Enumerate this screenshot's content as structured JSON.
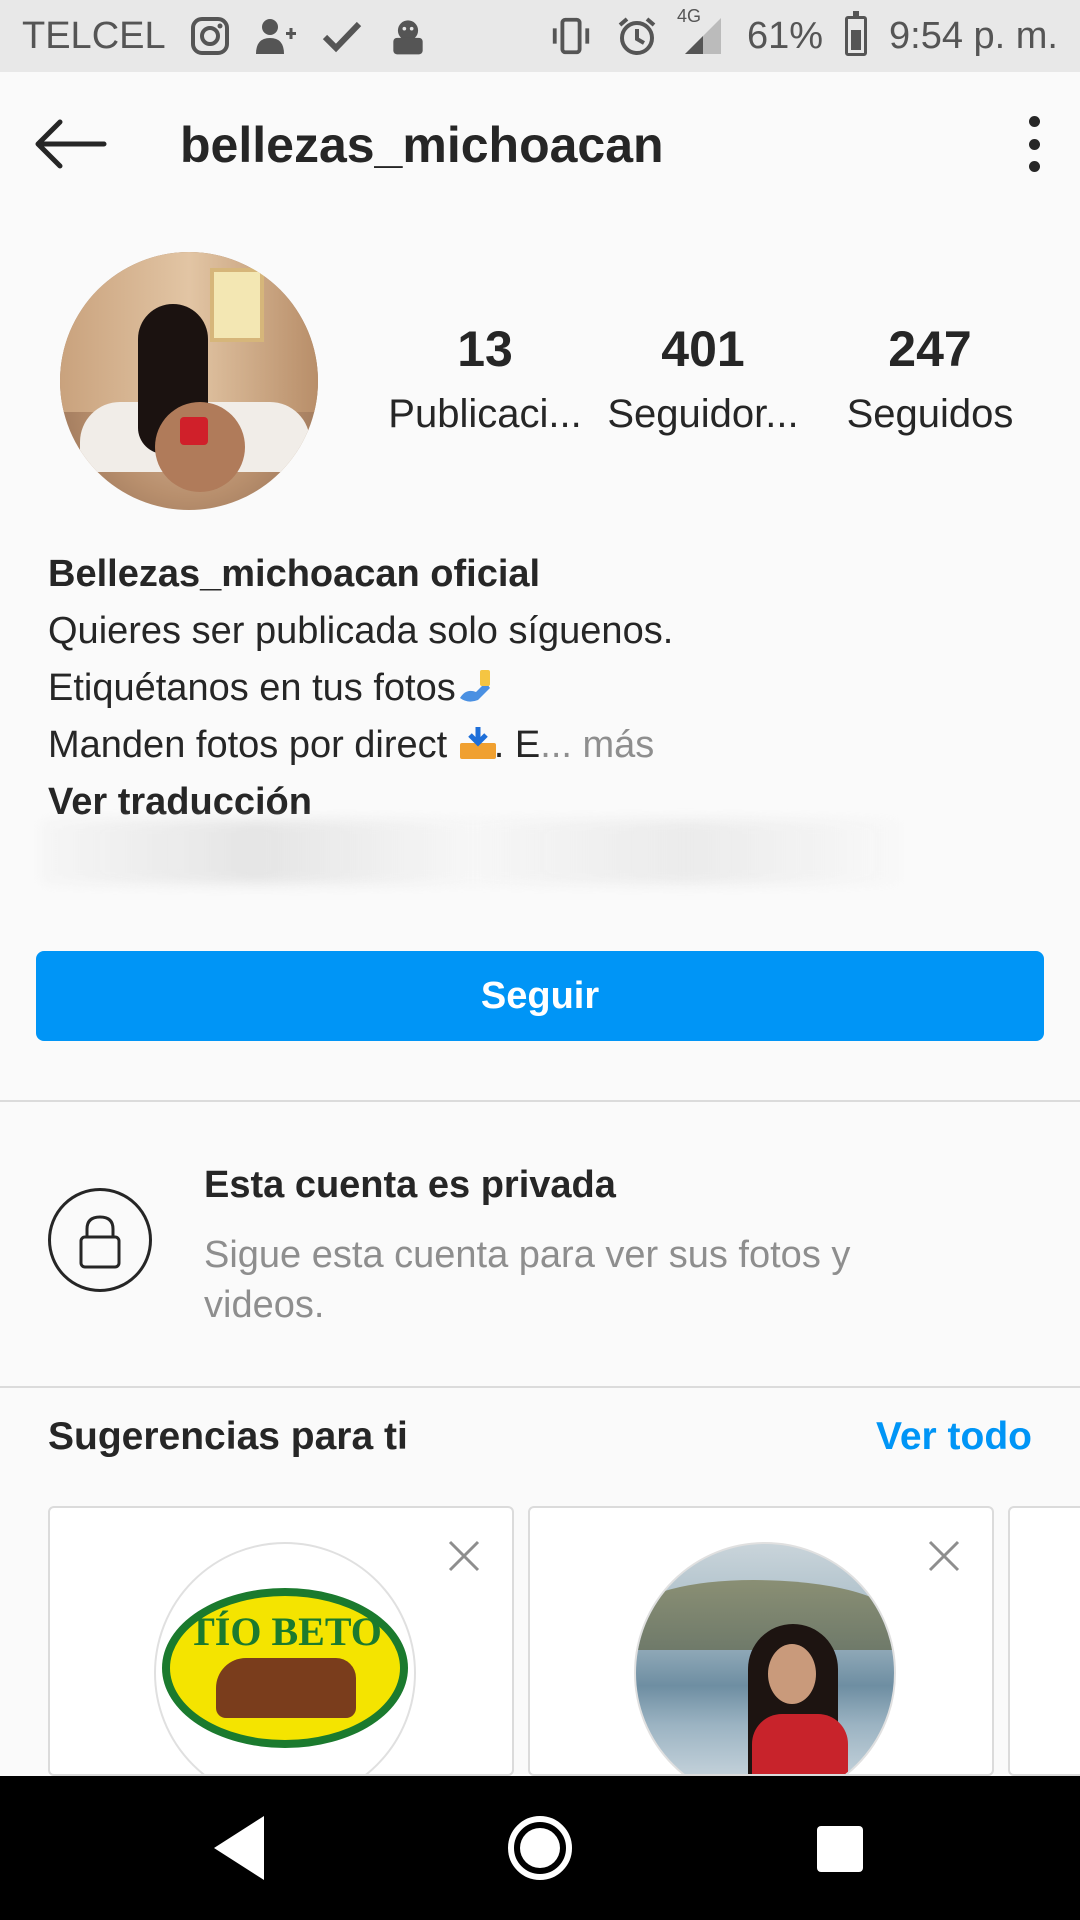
{
  "status_bar": {
    "carrier": "TELCEL",
    "network": "4G",
    "battery": "61%",
    "time": "9:54 p. m.",
    "icons": [
      "instagram-icon",
      "add-person-icon",
      "check-icon",
      "app-icon",
      "vibrate-icon",
      "alarm-icon",
      "signal-icon",
      "battery-icon"
    ]
  },
  "header": {
    "username": "bellezas_michoacan",
    "back_icon": "arrow-left-icon",
    "menu_icon": "more-vertical-icon"
  },
  "stats": [
    {
      "value": "13",
      "label": "Publicaci..."
    },
    {
      "value": "401",
      "label": "Seguidor..."
    },
    {
      "value": "247",
      "label": "Seguidos"
    }
  ],
  "bio": {
    "name": "Bellezas_michoacan oficial",
    "line1": "Quieres ser publicada solo síguenos.",
    "line2": "Etiquétanos en tus fotos",
    "line3": "Manden fotos por direct",
    "line3_suffix": ". E",
    "more": "... más",
    "translate": "Ver traducción"
  },
  "follow_button": {
    "label": "Seguir",
    "color": "#0095f6"
  },
  "private": {
    "title": "Esta cuenta es privada",
    "description": "Sigue esta cuenta para ver sus fotos y videos."
  },
  "suggestions": {
    "title": "Sugerencias para ti",
    "see_all": "Ver todo",
    "cards": [
      {
        "logo_text": "TÍO BETO"
      },
      {}
    ]
  }
}
